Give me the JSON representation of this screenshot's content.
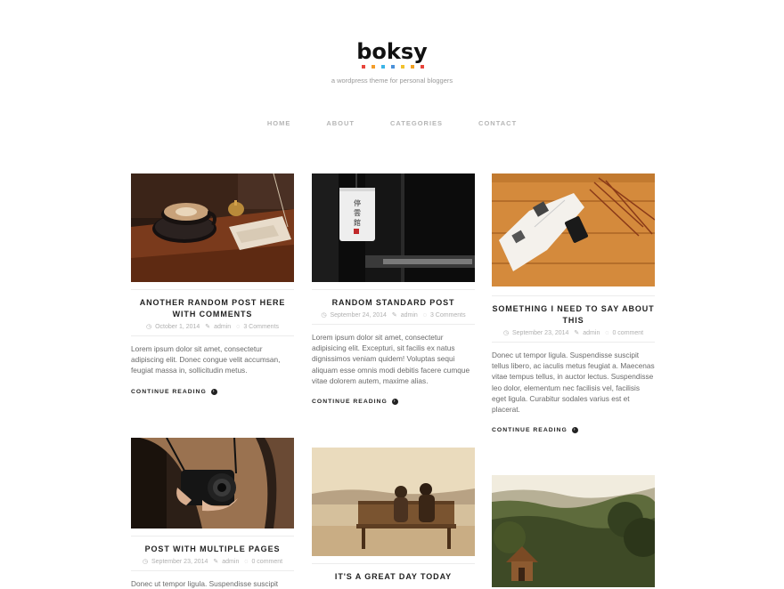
{
  "site": {
    "title": "boksy",
    "tagline": "a wordpress theme for personal bloggers",
    "dot_colors": [
      "#e8453c",
      "#f39c2a",
      "#3bb4e6",
      "#4a90d9",
      "#f2c12e",
      "#f3a122",
      "#e8453c"
    ]
  },
  "nav": [
    "HOME",
    "ABOUT",
    "CATEGORIES",
    "CONTACT"
  ],
  "posts": [
    {
      "title": "ANOTHER RANDOM POST HERE WITH COMMENTS",
      "date": "October 1, 2014",
      "author": "admin",
      "comments": "3 Comments",
      "excerpt": "Lorem ipsum dolor sit amet, consectetur adipiscing elit. Donec congue velit accumsan, feugiat massa in, sollicitudin metus.",
      "more": "CONTINUE READING",
      "image": "coffee-cup-photo"
    },
    {
      "title": "RANDOM STANDARD POST",
      "date": "September 24, 2014",
      "author": "admin",
      "comments": "3 Comments",
      "excerpt": "Lorem ipsum dolor sit amet, consectetur adipisicing elit. Excepturi, sit facilis ex natus dignissimos veniam quidem! Voluptas sequi aliquam esse omnis modi debitis facere cumque vitae dolorem autem, maxime alias.",
      "more": "CONTINUE READING",
      "image": "paper-lantern-photo"
    },
    {
      "title": "SOMETHING I NEED TO SAY ABOUT THIS",
      "date": "September 23, 2014",
      "author": "admin",
      "comments": "0 comment",
      "excerpt": "Donec ut tempor ligula. Suspendisse suscipit tellus libero, ac iaculis metus feugiat a. Maecenas vitae tempus tellus, in auctor lectus. Suspendisse leo dolor, elementum nec facilisis vel, facilisis eget ligula. Curabitur sodales varius est et placerat.",
      "more": "CONTINUE READING",
      "image": "open-magazine-photo"
    },
    {
      "title": "POST WITH MULTIPLE PAGES",
      "date": "September 23, 2014",
      "author": "admin",
      "comments": "0 comment",
      "excerpt": "Donec ut tempor ligula. Suspendisse suscipit",
      "image": "camera-photo"
    },
    {
      "title": "IT'S A GREAT DAY TODAY",
      "image": "bench-couple-photo"
    },
    {
      "image": "forest-cabin-photo"
    }
  ]
}
